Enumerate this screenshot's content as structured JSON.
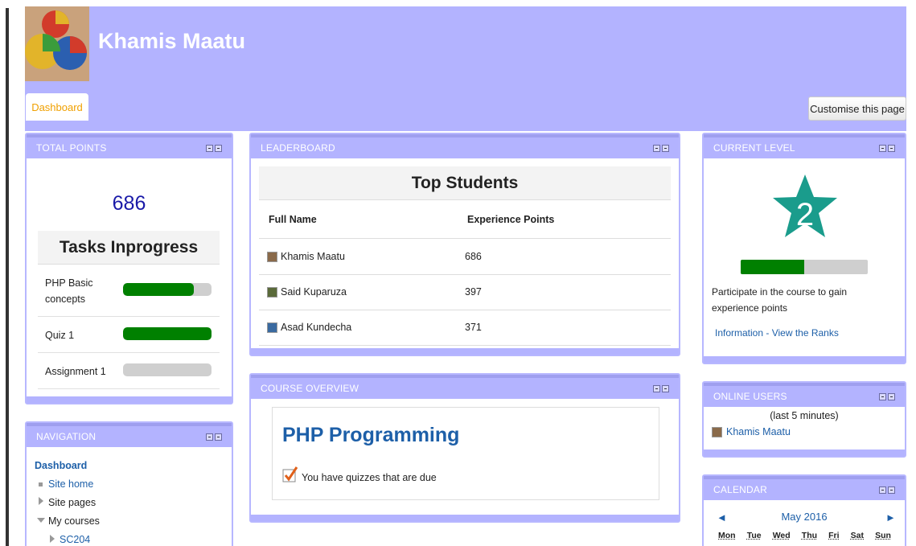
{
  "header": {
    "user_name": "Khamis Maatu",
    "dashboard_tab": "Dashboard",
    "customise_button": "Customise this page"
  },
  "total_points": {
    "title": "TOTAL POINTS",
    "points": "686",
    "tasks_title": "Tasks Inprogress",
    "tasks": [
      {
        "name": "PHP Basic concepts",
        "progress": 0.8
      },
      {
        "name": "Quiz 1",
        "progress": 1.0
      },
      {
        "name": "Assignment 1",
        "progress": 0.0
      }
    ]
  },
  "leaderboard": {
    "title": "LEADERBOARD",
    "heading": "Top Students",
    "col_name": "Full Name",
    "col_points": "Experience Points",
    "rows": [
      {
        "name": "Khamis Maatu",
        "points": "686"
      },
      {
        "name": "Said Kuparuza",
        "points": "397"
      },
      {
        "name": "Asad Kundecha",
        "points": "371"
      }
    ]
  },
  "course_overview": {
    "title": "COURSE OVERVIEW",
    "course_name": "PHP Programming",
    "note": "You have quizzes that are due"
  },
  "current_level": {
    "title": "CURRENT LEVEL",
    "level": "2",
    "progress": 0.5,
    "description": "Participate in the course to gain experience points",
    "link": "Information - View the Ranks",
    "star_color": "#1a9c8c"
  },
  "navigation": {
    "title": "NAVIGATION",
    "dashboard": "Dashboard",
    "site_home": "Site home",
    "site_pages": "Site pages",
    "my_courses": "My courses",
    "course": "SC204"
  },
  "online_users": {
    "title": "ONLINE USERS",
    "subtitle": "(last 5 minutes)",
    "user": "Khamis Maatu"
  },
  "calendar": {
    "title": "CALENDAR",
    "month": "May 2016",
    "prev": "◄",
    "next": "►",
    "days": [
      "Mon",
      "Tue",
      "Wed",
      "Thu",
      "Fri",
      "Sat",
      "Sun"
    ]
  },
  "colors": {
    "header_bg": "#b3b3ff",
    "progress_green": "#008000",
    "link_blue": "#1d5fa8"
  }
}
